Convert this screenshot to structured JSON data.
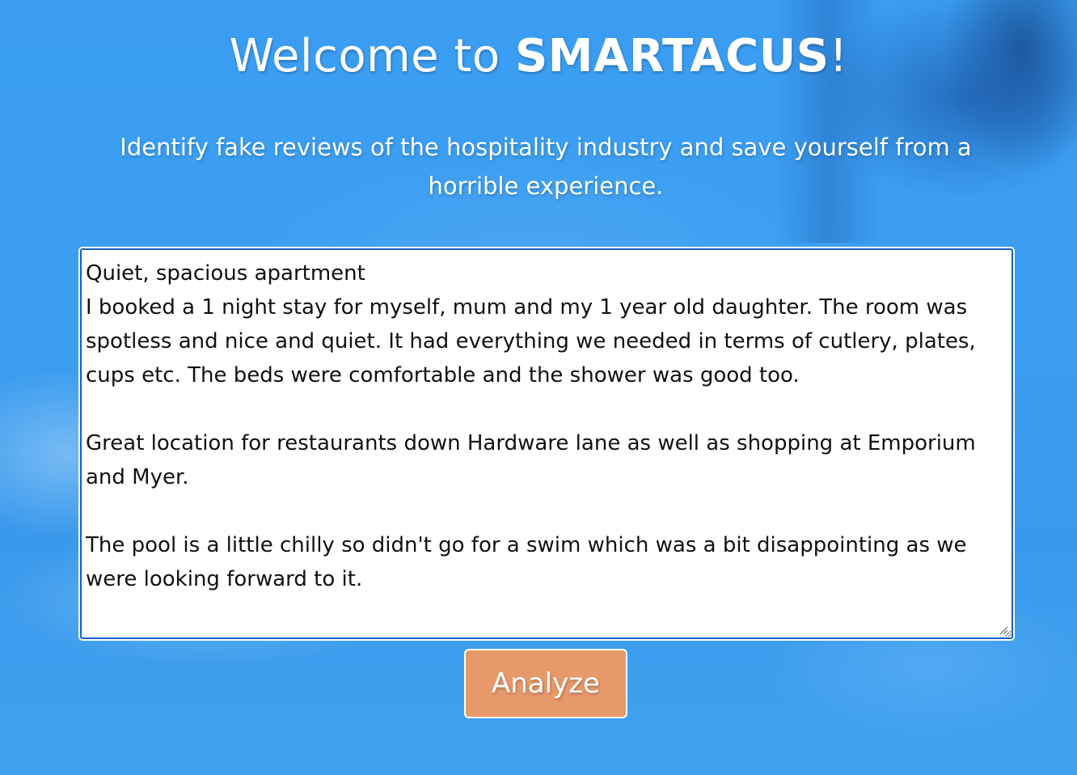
{
  "header": {
    "title_prefix": "Welcome to ",
    "title_brand": "SMARTACUS",
    "title_suffix": "!",
    "subtitle": "Identify fake reviews of the hospitality industry and save yourself from a horrible experience."
  },
  "review": {
    "value": "Quiet, spacious apartment\nI booked a 1 night stay for myself, mum and my 1 year old daughter. The room was spotless and nice and quiet. It had everything we needed in terms of cutlery, plates, cups etc. The beds were comfortable and the shower was good too.\n\nGreat location for restaurants down Hardware lane as well as shopping at Emporium and Myer.\n\nThe pool is a little chilly so didn't go for a swim which was a bit disappointing as we were looking forward to it."
  },
  "actions": {
    "analyze_label": "Analyze"
  },
  "colors": {
    "background": "#3a9cf0",
    "button": "#e8996a",
    "textarea_border": "#1660c4"
  }
}
